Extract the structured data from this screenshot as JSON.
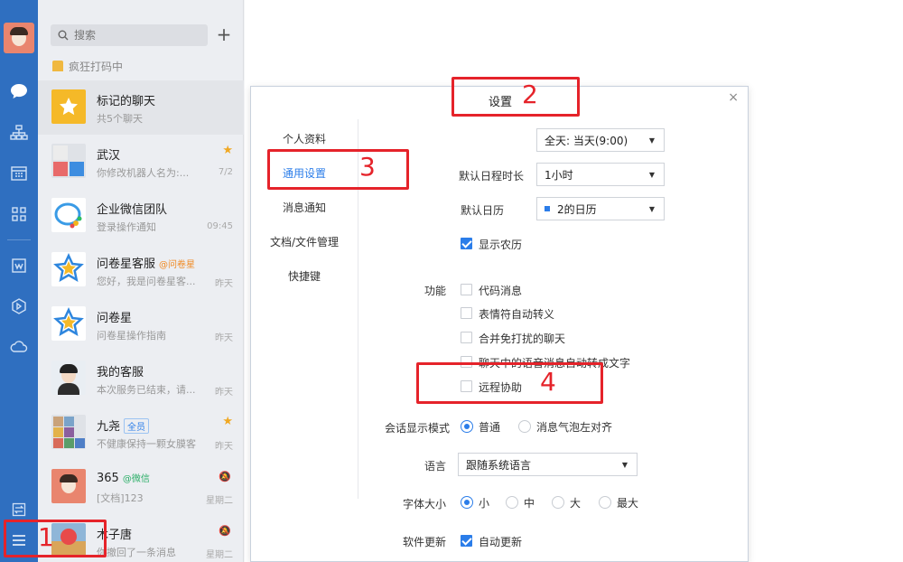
{
  "search": {
    "placeholder": "搜索"
  },
  "status_text": "疯狂打码中",
  "conversations": [
    {
      "name": "标记的聊天",
      "preview": "共5个聊天",
      "time": ""
    },
    {
      "name": "武汉",
      "preview": "你修改机器人名为:...",
      "time": "7/2"
    },
    {
      "name": "企业微信团队",
      "preview": "登录操作通知",
      "time": "09:45"
    },
    {
      "name": "问卷星客服",
      "tag": "@问卷星",
      "preview": "您好，我是问卷星客...",
      "time": "昨天"
    },
    {
      "name": "问卷星",
      "preview": "问卷星操作指南",
      "time": "昨天"
    },
    {
      "name": "我的客服",
      "preview": "本次服务已结束，请...",
      "time": "昨天"
    },
    {
      "name": "九尧",
      "tag": "全员",
      "preview": "不健康保持一颗女膜客",
      "time": "昨天"
    },
    {
      "name": "365",
      "tag": "@微信",
      "preview": "[文档]123",
      "time": "星期二"
    },
    {
      "name": "木子唐",
      "preview": "你撤回了一条消息",
      "time": "星期二"
    }
  ],
  "dialog": {
    "title": "设置",
    "close": "×",
    "menu": [
      "个人资料",
      "通用设置",
      "消息通知",
      "文档/文件管理",
      "快捷键"
    ],
    "reminder_select": "全天: 当天(9:00)",
    "duration_label": "默认日程时长",
    "duration_value": "1小时",
    "calendar_label": "默认日历",
    "calendar_value": "2的日历",
    "lunar_label": "显示农历",
    "function_label": "功能",
    "functions": [
      "代码消息",
      "表情符自动转义",
      "合并免打扰的聊天",
      "聊天中的语音消息自动转成文字",
      "远程协助"
    ],
    "display_mode_label": "会话显示模式",
    "display_modes": [
      "普通",
      "消息气泡左对齐"
    ],
    "language_label": "语言",
    "language_value": "跟随系统语言",
    "font_label": "字体大小",
    "font_sizes": [
      "小",
      "中",
      "大",
      "最大"
    ],
    "update_label": "软件更新",
    "update_value": "自动更新"
  },
  "annotations": [
    "1",
    "2",
    "3",
    "4"
  ],
  "colors": {
    "accent": "#2b7de9",
    "rail": "#2f6fc0",
    "annotation": "#e5232a"
  }
}
